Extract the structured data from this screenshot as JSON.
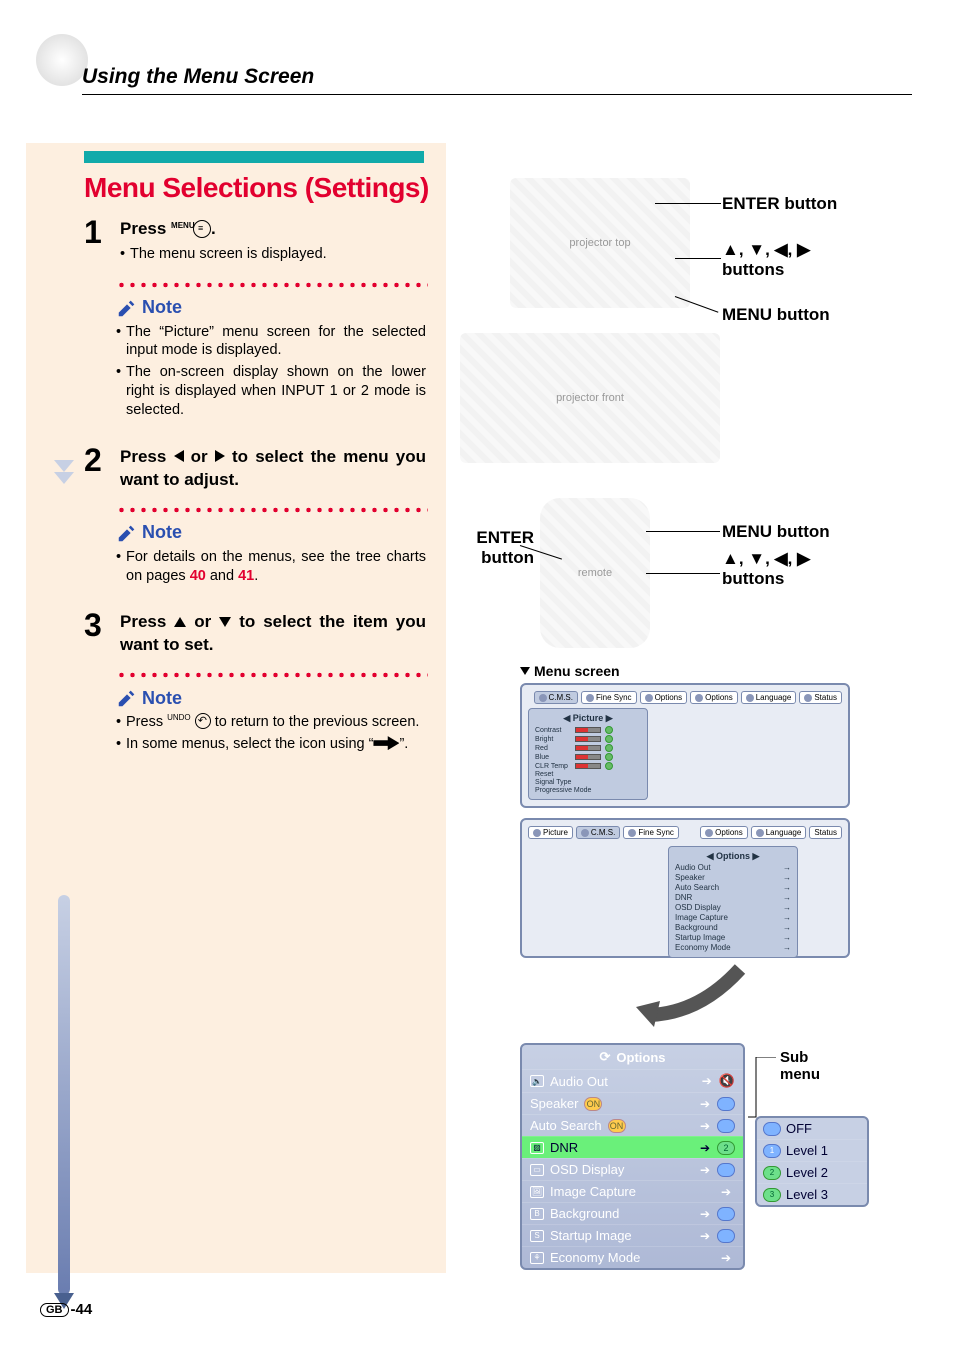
{
  "header": "Using the Menu Screen",
  "section_title": "Menu Selections (Settings)",
  "steps": {
    "s1": {
      "num": "1",
      "head_a": "Press ",
      "head_b": ".",
      "icon_label": "MENU",
      "bullets": [
        "The menu screen is displayed."
      ]
    },
    "s1_note": [
      "The “Picture” menu screen for the selected input mode is displayed.",
      "The on-screen display shown on the lower right is displayed when INPUT 1 or 2 mode is selected."
    ],
    "s2": {
      "num": "2",
      "head": "Press ◀ or ▶ to select the menu you want to adjust."
    },
    "s2_note_a": "For details on the menus, see the tree charts on pages ",
    "s2_note_p1": "40",
    "s2_note_mid": " and ",
    "s2_note_p2": "41",
    "s2_note_end": ".",
    "s3": {
      "num": "3",
      "head": "Press ▲ or ▼ to select the item you want to set."
    },
    "s3_note": {
      "a": "Press ",
      "a_label": "UNDO",
      "b": " to return to the previous screen.",
      "c": "In some menus, select the icon using “",
      "d": "”."
    }
  },
  "note_label": "Note",
  "right": {
    "enter_btn": "ENTER button",
    "arrow_btns": "▲, ▼, ◀, ▶ buttons",
    "menu_btn": "MENU button",
    "menu_screen": "Menu screen",
    "sub_menu": "Sub menu"
  },
  "menu_tabs": [
    {
      "label": "C.M.S.",
      "active": true
    },
    {
      "label": "Fine Sync"
    },
    {
      "label": "Options"
    },
    {
      "label": "Options"
    },
    {
      "label": "Language"
    },
    {
      "label": "Status"
    }
  ],
  "picture_panel": {
    "title": "Picture",
    "items": [
      "Contrast",
      "Bright",
      "Red",
      "Blue",
      "CLR Temp",
      "Reset",
      "Signal Type",
      "Progressive Mode"
    ]
  },
  "menu_tabs2": [
    {
      "label": "Picture"
    },
    {
      "label": "C.M.S.",
      "active": true
    },
    {
      "label": "Fine Sync"
    },
    {
      "label": "Options"
    },
    {
      "label": "Language"
    },
    {
      "label": "Status"
    }
  ],
  "options_mini": {
    "title": "Options",
    "items": [
      "Audio Out",
      "Speaker",
      "Auto Search",
      "DNR",
      "OSD Display",
      "Image Capture",
      "Background",
      "Startup Image",
      "Economy Mode"
    ]
  },
  "options_panel": {
    "title": "Options",
    "items": [
      {
        "icon": "🔈",
        "label": "Audio Out",
        "right": "🔇"
      },
      {
        "label": "Speaker",
        "badge": "ON",
        "rbadge": "blue"
      },
      {
        "label": "Auto Search",
        "badge": "ON",
        "rbadge": "blue"
      },
      {
        "icon": "▨",
        "label": "DNR",
        "hl": true,
        "rbadge": "green",
        "rnum": "2"
      },
      {
        "icon": "▭",
        "label": "OSD Display",
        "rbadge": "blue"
      },
      {
        "icon": "🖼",
        "label": "Image Capture"
      },
      {
        "icon": "B",
        "label": "Background",
        "rbadge": "blue"
      },
      {
        "icon": "S",
        "label": "Startup Image",
        "rbadge": "blue"
      },
      {
        "icon": "⚘",
        "label": "Economy Mode"
      }
    ]
  },
  "submenu": {
    "items": [
      {
        "b": "blue",
        "label": "OFF"
      },
      {
        "b": "blue",
        "label": "Level 1"
      },
      {
        "b": "green",
        "label": "Level 2"
      },
      {
        "b": "green",
        "label": "Level 3"
      }
    ]
  },
  "footer": {
    "gb": "GB",
    "page": "-44"
  }
}
